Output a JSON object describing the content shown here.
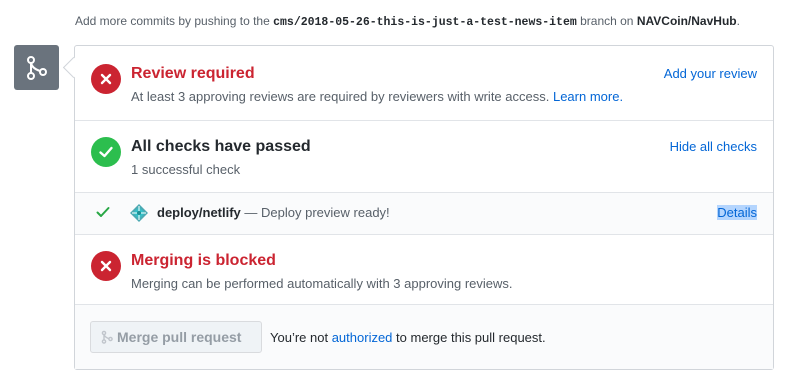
{
  "branch_note": {
    "prefix": "Add more commits by pushing to the",
    "branch": "cms/2018-05-26-this-is-just-a-test-news-item",
    "middle": "branch on",
    "repo": "NAVCoin/NavHub",
    "suffix": "."
  },
  "review": {
    "title": "Review required",
    "description": "At least 3 approving reviews are required by reviewers with write access.",
    "learn_more": "Learn more.",
    "action": "Add your review",
    "icon": "x-icon",
    "color": "#cb2431"
  },
  "checks": {
    "title": "All checks have passed",
    "summary": "1 successful check",
    "action": "Hide all checks",
    "icon": "check-icon",
    "color": "#2cbe4e",
    "items": [
      {
        "context": "deploy/netlify",
        "separator": "—",
        "description": "Deploy preview ready!",
        "details": "Details",
        "icon": "netlify-icon"
      }
    ]
  },
  "blocked": {
    "title": "Merging is blocked",
    "description": "Merging can be performed automatically with 3 approving reviews.",
    "icon": "x-icon",
    "color": "#cb2431"
  },
  "footer": {
    "merge_button": "Merge pull request",
    "note_prefix": "You’re not",
    "note_link": "authorized",
    "note_suffix": "to merge this pull request."
  },
  "colors": {
    "link": "#0366d6",
    "muted": "#586069",
    "avatar_bg": "#6a737d"
  }
}
